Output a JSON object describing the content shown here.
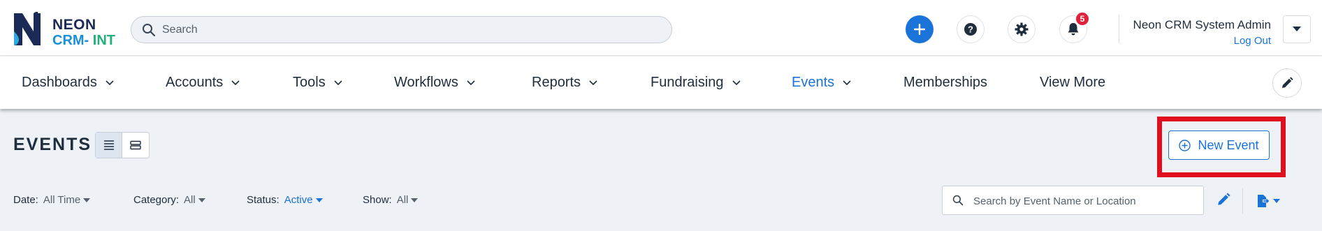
{
  "brand": {
    "name_top": "NEON",
    "name_bottom_crm": "CRM",
    "name_bottom_sep": "- ",
    "name_bottom_env": "INT"
  },
  "search": {
    "placeholder": "Search",
    "value": ""
  },
  "header": {
    "notifications_count": "5",
    "user_name": "Neon CRM System Admin",
    "logout_label": "Log Out"
  },
  "nav": {
    "items": [
      {
        "label": "Dashboards",
        "has_dropdown": true
      },
      {
        "label": "Accounts",
        "has_dropdown": true
      },
      {
        "label": "Tools",
        "has_dropdown": true
      },
      {
        "label": "Workflows",
        "has_dropdown": true
      },
      {
        "label": "Reports",
        "has_dropdown": true
      },
      {
        "label": "Fundraising",
        "has_dropdown": true
      },
      {
        "label": "Events",
        "has_dropdown": true,
        "active": true
      },
      {
        "label": "Memberships",
        "has_dropdown": false
      },
      {
        "label": "View More",
        "has_dropdown": false
      }
    ]
  },
  "page": {
    "title": "EVENTS",
    "new_event_label": "New Event"
  },
  "filters": {
    "date": {
      "label": "Date:",
      "value": "All Time"
    },
    "category": {
      "label": "Category:",
      "value": "All"
    },
    "status": {
      "label": "Status:",
      "value": "Active"
    },
    "show": {
      "label": "Show:",
      "value": "All"
    }
  },
  "event_search": {
    "placeholder": "Search by Event Name or Location",
    "value": ""
  },
  "colors": {
    "primary": "#1a73d9",
    "highlight": "#e0101e",
    "badge": "#e0213c",
    "text": "#1f2d3d"
  },
  "icons": [
    "logo-icon",
    "search-icon",
    "plus-icon",
    "help-icon",
    "gear-icon",
    "bell-icon",
    "chevron-down-icon",
    "pencil-icon",
    "list-view-icon",
    "card-view-icon",
    "plus-circle-icon",
    "export-icon"
  ]
}
